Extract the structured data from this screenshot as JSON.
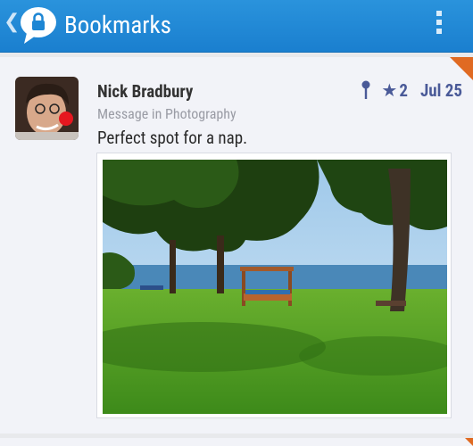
{
  "appbar": {
    "title": "Bookmarks",
    "back_icon": "chevron-left-icon",
    "app_icon": "speech-bubble-lock-icon",
    "menu_icon": "overflow-menu-icon"
  },
  "post": {
    "author": "Nick Bradbury",
    "forum": "Message in Photography",
    "body": "Perfect spot for a nap.",
    "pin_icon": "pin-icon",
    "star_icon": "star-icon",
    "stars": "2",
    "date": "Jul 25",
    "image_icon": "photo"
  },
  "colors": {
    "appbar": "#1d86d4",
    "accent_orange": "#e06a22",
    "meta": "#4a5a98"
  }
}
